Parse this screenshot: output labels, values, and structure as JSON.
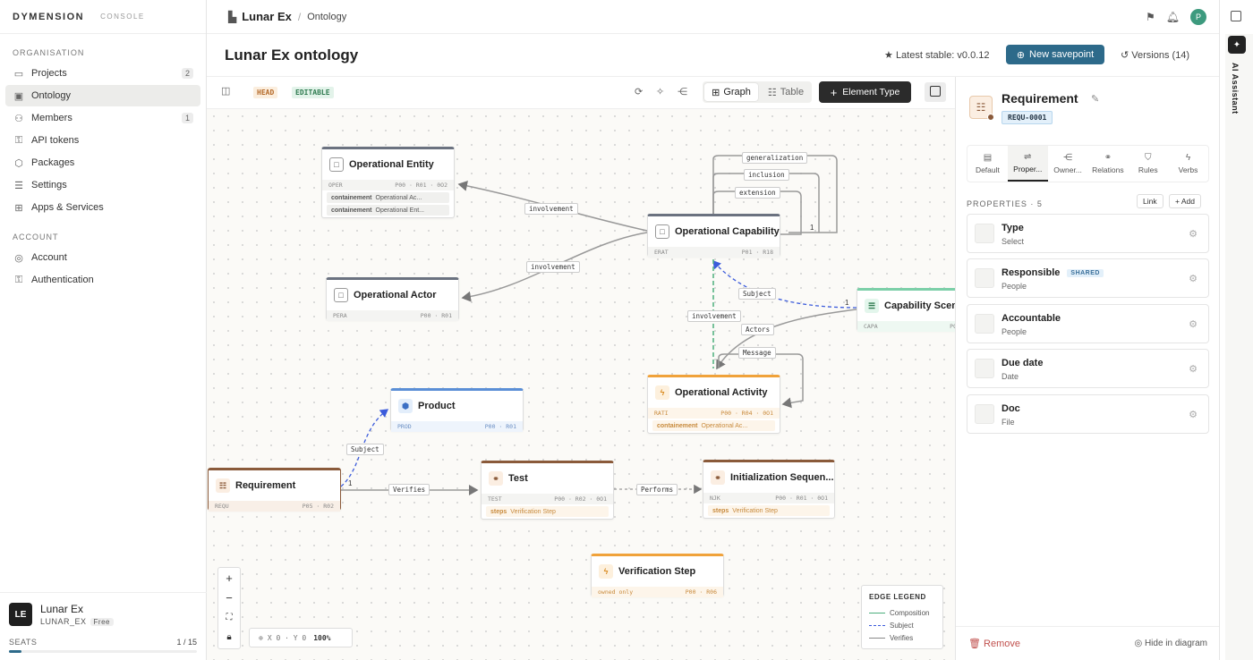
{
  "app": {
    "brand": "DYMENSION",
    "console": "CONSOLE"
  },
  "sidebar": {
    "org_section": "ORGANISATION",
    "org_items": [
      {
        "label": "Projects",
        "count": "2",
        "icon": "folder-icon"
      },
      {
        "label": "Ontology",
        "icon": "ontology-icon",
        "active": true
      },
      {
        "label": "Members",
        "count": "1",
        "icon": "members-icon"
      },
      {
        "label": "API tokens",
        "icon": "key-icon"
      },
      {
        "label": "Packages",
        "icon": "package-icon"
      },
      {
        "label": "Settings",
        "icon": "settings-icon"
      },
      {
        "label": "Apps & Services",
        "icon": "apps-icon"
      }
    ],
    "account_section": "ACCOUNT",
    "account_items": [
      {
        "label": "Account",
        "icon": "account-icon"
      },
      {
        "label": "Authentication",
        "icon": "key-icon"
      }
    ],
    "org": {
      "initials": "LE",
      "name": "Lunar Ex",
      "handle": "LUNAR_EX",
      "plan": "Free",
      "seats_label": "SEATS",
      "seats": "1 / 15",
      "seats_used": 1,
      "seats_total": 15
    }
  },
  "topbar": {
    "project": "Lunar Ex",
    "page": "Ontology",
    "user_initial": "P"
  },
  "header": {
    "title": "Lunar Ex ontology",
    "stable": "Latest stable: v0.0.12",
    "savepoint": "New savepoint",
    "versions": "Versions (14)"
  },
  "toolbar": {
    "head_tag": "HEAD",
    "editable_tag": "EDITABLE",
    "graph": "Graph",
    "table": "Table",
    "add": "Element Type"
  },
  "nodes": {
    "op_entity": {
      "title": "Operational Entity",
      "code": "OPER",
      "meta": "P00 · R01 · 0O2",
      "rows": [
        {
          "k": "containement",
          "v": "Operational Ac..."
        },
        {
          "k": "containement",
          "v": "Operational Ent..."
        }
      ]
    },
    "op_actor": {
      "title": "Operational Actor",
      "code": "PERA",
      "meta": "P00 · R01"
    },
    "op_capability": {
      "title": "Operational Capability",
      "code": "ERAT",
      "meta": "P01 · R18"
    },
    "capability_scenario": {
      "title": "Capability Scena",
      "code": "CAPA",
      "meta": "PO"
    },
    "op_activity": {
      "title": "Operational Activity",
      "code": "RATI",
      "meta": "P00 · R04 · 0O1",
      "rows": [
        {
          "k": "containement",
          "v": "Operational Ac..."
        }
      ]
    },
    "product": {
      "title": "Product",
      "code": "PROD",
      "meta": "P00 · R01"
    },
    "requirement": {
      "title": "Requirement",
      "code": "REQU",
      "meta": "P05 · R02"
    },
    "test": {
      "title": "Test",
      "code": "TEST",
      "meta": "P00 · R02 · 0O1",
      "rows": [
        {
          "k": "steps",
          "v": "Verification Step"
        }
      ]
    },
    "init_seq": {
      "title": "Initialization Sequen...",
      "code": "NJK",
      "meta": "P00 · R01 · 0O1",
      "rows": [
        {
          "k": "steps",
          "v": "Verification Step"
        }
      ]
    },
    "verif_step": {
      "title": "Verification Step",
      "code": "owned only",
      "meta": "P00 · R06"
    }
  },
  "edge_labels": {
    "involvement1": "involvement",
    "involvement2": "involvement",
    "involvement3": "involvement",
    "generalization": "generalization",
    "inclusion": "inclusion",
    "extension": "extension",
    "subject1": "Subject",
    "actors": "Actors",
    "message": "Message",
    "subject2": "Subject",
    "verifies": "Verifies",
    "performs": "Performs",
    "one1": "1",
    "one2": "1",
    "one3": "1"
  },
  "canvas": {
    "coords": "X 0 · Y 0",
    "zoom": "100%"
  },
  "legend": {
    "title": "EDGE LEGEND",
    "items": [
      {
        "label": "Composition",
        "color": "#4caf7d"
      },
      {
        "label": "Subject",
        "color": "#3b5bdb"
      },
      {
        "label": "Verifies",
        "color": "#888888"
      }
    ]
  },
  "panel": {
    "title": "Requirement",
    "id": "REQU-0001",
    "tabs": [
      {
        "label": "Default",
        "icon": "default-icon"
      },
      {
        "label": "Proper...",
        "icon": "sliders-icon",
        "active": true
      },
      {
        "label": "Owner...",
        "icon": "owner-icon"
      },
      {
        "label": "Relations",
        "icon": "link-icon"
      },
      {
        "label": "Rules",
        "icon": "shield-icon"
      },
      {
        "label": "Verbs",
        "icon": "bolt-icon"
      }
    ],
    "props_header": "PROPERTIES · 5",
    "link_btn": "Link",
    "add_btn": "+ Add",
    "properties": [
      {
        "name": "Type",
        "type": "Select"
      },
      {
        "name": "Responsible",
        "type": "People",
        "badge": "SHARED"
      },
      {
        "name": "Accountable",
        "type": "People"
      },
      {
        "name": "Due date",
        "type": "Date"
      },
      {
        "name": "Doc",
        "type": "File"
      }
    ],
    "remove": "Remove",
    "hide": "Hide in diagram"
  },
  "ai": {
    "label": "AI Assistant"
  }
}
